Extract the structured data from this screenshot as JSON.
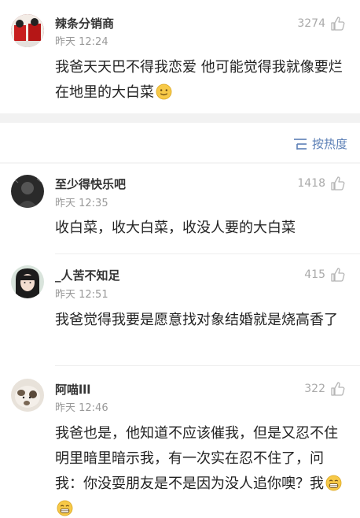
{
  "sort": {
    "label": "按热度",
    "icon": "sort-lines-icon"
  },
  "comments": [
    {
      "username": "辣条分销商",
      "time": "昨天 12:24",
      "likes": "3274",
      "text": "我爸天天巴不得我恋爱 他可能觉得我就像要烂在地里的大白菜",
      "emoji": [
        "smile-emoji"
      ]
    },
    {
      "username": "至少得快乐吧",
      "time": "昨天 12:35",
      "likes": "1418",
      "text": "收白菜，收大白菜，收没人要的大白菜",
      "emoji": []
    },
    {
      "username": "_人苦不知足",
      "time": "昨天 12:51",
      "likes": "415",
      "text": "我爸觉得我要是愿意找对象结婚就是烧高香了",
      "emoji": []
    },
    {
      "username": "阿喵lll",
      "time": "昨天 12:46",
      "likes": "322",
      "text": "我爸也是，他知道不应该催我，但是又忍不住明里暗里暗示我，有一次实在忍不住了，问我：你没耍朋友是不是因为没人追你噢？我",
      "emoji": [
        "grin-emoji",
        "grin-emoji"
      ]
    }
  ],
  "colors": {
    "accent": "#5b7fb6",
    "muted": "#999999",
    "band": "#f2f2f2",
    "emoji_yellow": "#f7c948"
  }
}
